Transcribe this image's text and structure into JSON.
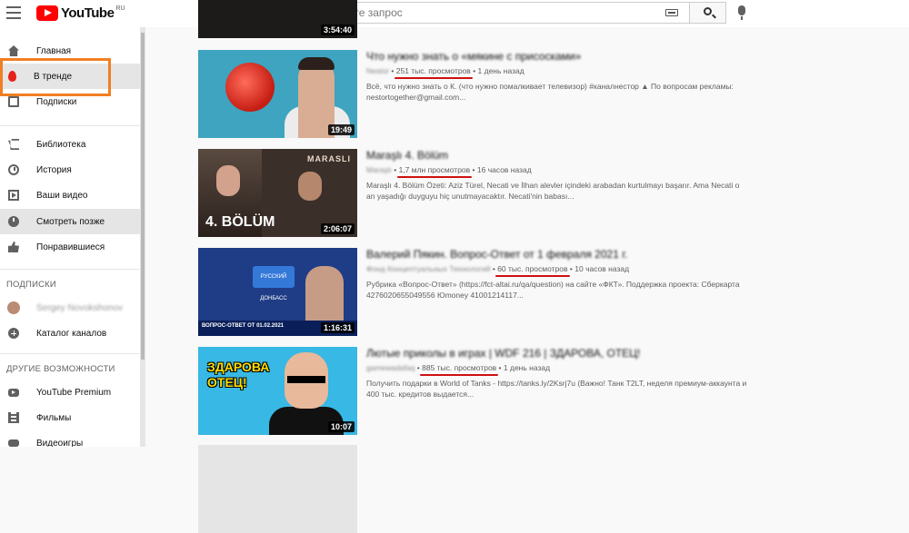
{
  "header": {
    "logo_text": "YouTube",
    "logo_region": "RU",
    "search_placeholder": "Введите запрос"
  },
  "sidebar": {
    "items": [
      {
        "label": "Главная",
        "icon": "home-icon"
      },
      {
        "label": "В тренде",
        "icon": "fire-icon",
        "active": true
      },
      {
        "label": "Подписки",
        "icon": "subscriptions-icon"
      },
      {
        "label": "Библиотека",
        "icon": "library-icon"
      },
      {
        "label": "История",
        "icon": "history-icon"
      },
      {
        "label": "Ваши видео",
        "icon": "your-videos-icon"
      },
      {
        "label": "Смотреть позже",
        "icon": "watch-later-icon",
        "active": true
      },
      {
        "label": "Понравившиеся",
        "icon": "thumbs-up-icon"
      }
    ],
    "subscriptions_title": "ПОДПИСКИ",
    "subscription_name": "Sergey Novokshonov",
    "channels_catalog": "Каталог каналов",
    "more_title": "ДРУГИЕ ВОЗМОЖНОСТИ",
    "more_items": [
      {
        "label": "YouTube Premium",
        "icon": "youtube-premium-icon"
      },
      {
        "label": "Фильмы",
        "icon": "film-icon"
      },
      {
        "label": "Видеоигры",
        "icon": "gamepad-icon"
      }
    ]
  },
  "videos": [
    {
      "duration": "3:54:40"
    },
    {
      "title": "Что нужно знать о «мякине с присосками»",
      "channel": "Nestor",
      "views": "251 тыс. просмотров",
      "age": "1 день назад",
      "description": "Всё, что нужно знать о К. (что нужно помалкивает телевизор) #каналнестор ▲ По вопросам рекламы: nestortogether@gmail.com...",
      "duration": "19:49"
    },
    {
      "title": "Maraşlı 4. Bölüm",
      "channel": "Maraşlı",
      "views": "1,7 млн просмотров",
      "age": "16 часов назад",
      "description": "Maraşlı 4. Bölüm Özeti: Aziz Türel, Necati ve İlhan alevler içindeki arabadan kurtulmayı başarır. Ama Necati o an yaşadığı duyguyu hiç unutmayacaktır. Necati'nin babası...",
      "duration": "2:06:07",
      "thumb_label": "4. BÖLÜM",
      "thumb_brand": "MARASLI"
    },
    {
      "title": "Валерий Пякин. Вопрос-Ответ от 1 февраля 2021 г.",
      "channel": "Фонд Концептуальных Технологий",
      "views": "60 тыс. просмотров",
      "age": "10 часов назад",
      "description": "Рубрика «Вопрос-Ответ» (https://fct-altai.ru/qa/question) на сайте «ФКТ». Поддержка проекта: Сберкарта 4276020655049556 Юmoney 41001214117...",
      "duration": "1:16:31",
      "thumb_banner": "ВОПРОС-ОТВЕТ ОТ 01.02.2021",
      "thumb_logo": "РУССКИЙ ДОНБАСС"
    },
    {
      "title": "Лютые приколы в играх | WDF 216 | ЗДАРОВА, ОТЕЦ!",
      "channel": "gamewadafaq",
      "views": "885 тыс. просмотров",
      "age": "1 день назад",
      "description": "Получить подарки в World of Tanks - https://tanks.ly/2Ksrj7u (Важно! Танк T2LT, неделя премиум-аккаунта и 400 тыс. кредитов выдается...",
      "duration": "10:07",
      "thumb_caption_line1": "ЗДАРОВА",
      "thumb_caption_line2": "ОТЕЦ!"
    }
  ],
  "colors": {
    "highlight_box": "#f07f23",
    "views_underline": "#d01010",
    "youtube_red": "#ff0000"
  }
}
